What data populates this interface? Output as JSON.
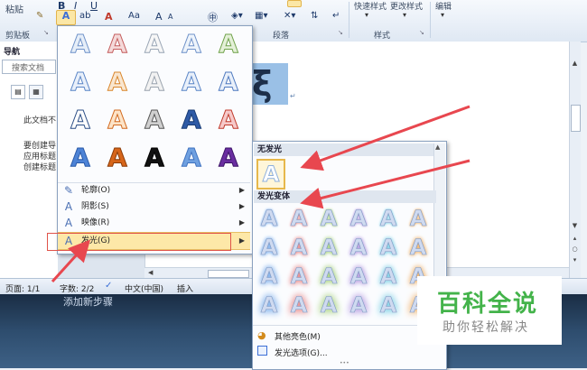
{
  "ribbon": {
    "paste": "粘贴",
    "clipboard": "剪贴板",
    "paragraph": "段落",
    "styles": "样式",
    "quick_styles": "快速样式",
    "change_styles": "更改样式",
    "edit": "编辑",
    "font_bold": "B",
    "font_italic": "I",
    "font_underline": "U",
    "font_size_btn": "Aa",
    "grow": "A",
    "shrink": "A"
  },
  "nav": {
    "title": "导航",
    "search_placeholder": "搜索文档",
    "line1": "此文档不",
    "line2": "要创建导",
    "line3": "应用标题",
    "line4": "创建标题"
  },
  "status": {
    "page": "页面: 1/1",
    "words": "字数: 2/2",
    "lang": "中文(中国)",
    "mode": "插入"
  },
  "effects_menu": {
    "letters": [
      "A",
      "A",
      "A",
      "A",
      "A",
      "A",
      "A",
      "A",
      "A",
      "A",
      "A",
      "A",
      "A",
      "A",
      "A",
      "A",
      "A",
      "A",
      "A",
      "A"
    ],
    "items": [
      {
        "label": "轮廓(O)"
      },
      {
        "label": "阴影(S)"
      },
      {
        "label": "映像(R)"
      },
      {
        "label": "发光(G)"
      }
    ]
  },
  "glow_menu": {
    "no_glow_header": "无发光",
    "no_glow_letter": "A",
    "variants_header": "发光变体",
    "letters": [
      "A",
      "A",
      "A",
      "A",
      "A",
      "A",
      "A",
      "A",
      "A",
      "A",
      "A",
      "A",
      "A",
      "A",
      "A",
      "A",
      "A",
      "A",
      "A",
      "A",
      "A",
      "A",
      "A",
      "A"
    ],
    "more_colors": "其他亮色(M)",
    "options": "发光选项(G)..."
  },
  "taskbar_text": "添加新步骤",
  "watermark": {
    "title": "百科全说",
    "subtitle": "助你轻松解决"
  },
  "colors": {
    "highlight": "#f9d36a",
    "arrow": "#e8474f",
    "accent_blue": "#3c6fd6"
  }
}
